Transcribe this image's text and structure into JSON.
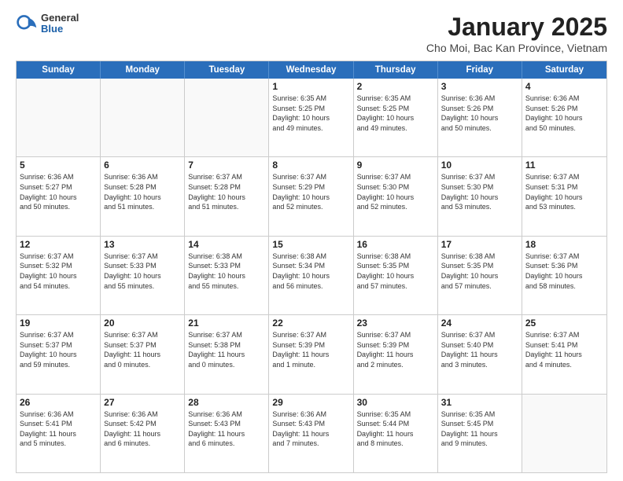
{
  "logo": {
    "general": "General",
    "blue": "Blue"
  },
  "header": {
    "title": "January 2025",
    "subtitle": "Cho Moi, Bac Kan Province, Vietnam"
  },
  "weekdays": [
    "Sunday",
    "Monday",
    "Tuesday",
    "Wednesday",
    "Thursday",
    "Friday",
    "Saturday"
  ],
  "weeks": [
    [
      {
        "day": "",
        "info": ""
      },
      {
        "day": "",
        "info": ""
      },
      {
        "day": "",
        "info": ""
      },
      {
        "day": "1",
        "info": "Sunrise: 6:35 AM\nSunset: 5:25 PM\nDaylight: 10 hours\nand 49 minutes."
      },
      {
        "day": "2",
        "info": "Sunrise: 6:35 AM\nSunset: 5:25 PM\nDaylight: 10 hours\nand 49 minutes."
      },
      {
        "day": "3",
        "info": "Sunrise: 6:36 AM\nSunset: 5:26 PM\nDaylight: 10 hours\nand 50 minutes."
      },
      {
        "day": "4",
        "info": "Sunrise: 6:36 AM\nSunset: 5:26 PM\nDaylight: 10 hours\nand 50 minutes."
      }
    ],
    [
      {
        "day": "5",
        "info": "Sunrise: 6:36 AM\nSunset: 5:27 PM\nDaylight: 10 hours\nand 50 minutes."
      },
      {
        "day": "6",
        "info": "Sunrise: 6:36 AM\nSunset: 5:28 PM\nDaylight: 10 hours\nand 51 minutes."
      },
      {
        "day": "7",
        "info": "Sunrise: 6:37 AM\nSunset: 5:28 PM\nDaylight: 10 hours\nand 51 minutes."
      },
      {
        "day": "8",
        "info": "Sunrise: 6:37 AM\nSunset: 5:29 PM\nDaylight: 10 hours\nand 52 minutes."
      },
      {
        "day": "9",
        "info": "Sunrise: 6:37 AM\nSunset: 5:30 PM\nDaylight: 10 hours\nand 52 minutes."
      },
      {
        "day": "10",
        "info": "Sunrise: 6:37 AM\nSunset: 5:30 PM\nDaylight: 10 hours\nand 53 minutes."
      },
      {
        "day": "11",
        "info": "Sunrise: 6:37 AM\nSunset: 5:31 PM\nDaylight: 10 hours\nand 53 minutes."
      }
    ],
    [
      {
        "day": "12",
        "info": "Sunrise: 6:37 AM\nSunset: 5:32 PM\nDaylight: 10 hours\nand 54 minutes."
      },
      {
        "day": "13",
        "info": "Sunrise: 6:37 AM\nSunset: 5:33 PM\nDaylight: 10 hours\nand 55 minutes."
      },
      {
        "day": "14",
        "info": "Sunrise: 6:38 AM\nSunset: 5:33 PM\nDaylight: 10 hours\nand 55 minutes."
      },
      {
        "day": "15",
        "info": "Sunrise: 6:38 AM\nSunset: 5:34 PM\nDaylight: 10 hours\nand 56 minutes."
      },
      {
        "day": "16",
        "info": "Sunrise: 6:38 AM\nSunset: 5:35 PM\nDaylight: 10 hours\nand 57 minutes."
      },
      {
        "day": "17",
        "info": "Sunrise: 6:38 AM\nSunset: 5:35 PM\nDaylight: 10 hours\nand 57 minutes."
      },
      {
        "day": "18",
        "info": "Sunrise: 6:37 AM\nSunset: 5:36 PM\nDaylight: 10 hours\nand 58 minutes."
      }
    ],
    [
      {
        "day": "19",
        "info": "Sunrise: 6:37 AM\nSunset: 5:37 PM\nDaylight: 10 hours\nand 59 minutes."
      },
      {
        "day": "20",
        "info": "Sunrise: 6:37 AM\nSunset: 5:37 PM\nDaylight: 11 hours\nand 0 minutes."
      },
      {
        "day": "21",
        "info": "Sunrise: 6:37 AM\nSunset: 5:38 PM\nDaylight: 11 hours\nand 0 minutes."
      },
      {
        "day": "22",
        "info": "Sunrise: 6:37 AM\nSunset: 5:39 PM\nDaylight: 11 hours\nand 1 minute."
      },
      {
        "day": "23",
        "info": "Sunrise: 6:37 AM\nSunset: 5:39 PM\nDaylight: 11 hours\nand 2 minutes."
      },
      {
        "day": "24",
        "info": "Sunrise: 6:37 AM\nSunset: 5:40 PM\nDaylight: 11 hours\nand 3 minutes."
      },
      {
        "day": "25",
        "info": "Sunrise: 6:37 AM\nSunset: 5:41 PM\nDaylight: 11 hours\nand 4 minutes."
      }
    ],
    [
      {
        "day": "26",
        "info": "Sunrise: 6:36 AM\nSunset: 5:41 PM\nDaylight: 11 hours\nand 5 minutes."
      },
      {
        "day": "27",
        "info": "Sunrise: 6:36 AM\nSunset: 5:42 PM\nDaylight: 11 hours\nand 6 minutes."
      },
      {
        "day": "28",
        "info": "Sunrise: 6:36 AM\nSunset: 5:43 PM\nDaylight: 11 hours\nand 6 minutes."
      },
      {
        "day": "29",
        "info": "Sunrise: 6:36 AM\nSunset: 5:43 PM\nDaylight: 11 hours\nand 7 minutes."
      },
      {
        "day": "30",
        "info": "Sunrise: 6:35 AM\nSunset: 5:44 PM\nDaylight: 11 hours\nand 8 minutes."
      },
      {
        "day": "31",
        "info": "Sunrise: 6:35 AM\nSunset: 5:45 PM\nDaylight: 11 hours\nand 9 minutes."
      },
      {
        "day": "",
        "info": ""
      }
    ]
  ]
}
